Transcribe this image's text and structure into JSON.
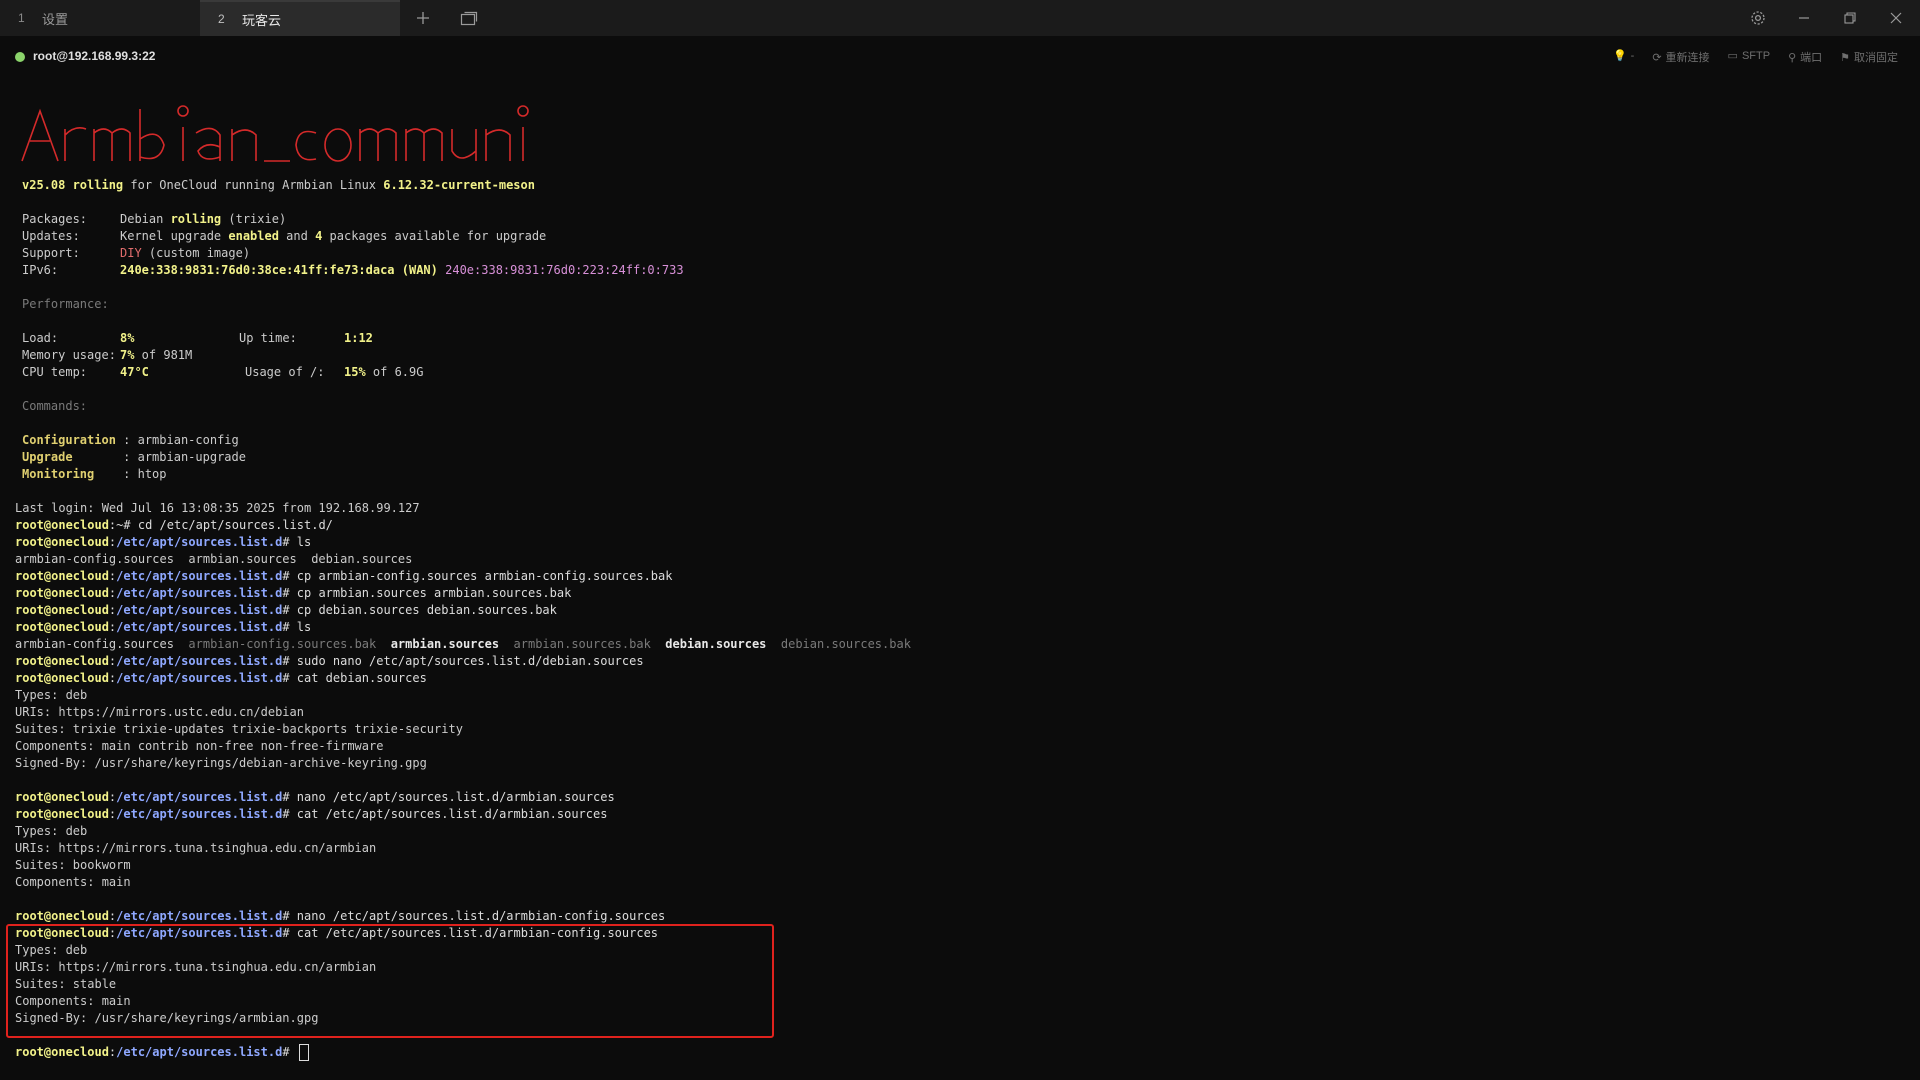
{
  "tabs": [
    {
      "num": "1",
      "label": "设置"
    },
    {
      "num": "2",
      "label": "玩客云"
    }
  ],
  "session": {
    "host": "root@192.168.99.3:22",
    "actions": [
      {
        "icon": "bulb-icon",
        "label": "-"
      },
      {
        "icon": "refresh-icon",
        "label": "重新连接"
      },
      {
        "icon": "folder-icon",
        "label": "SFTP"
      },
      {
        "icon": "plug-icon",
        "label": "端口"
      },
      {
        "icon": "pin-icon",
        "label": "取消固定"
      }
    ]
  },
  "banner_art_text": "Armbian_community",
  "motd": {
    "version": "v25.08 rolling",
    "for_text": " for OneCloud running Armbian Linux ",
    "kernel": "6.12.32-current-meson",
    "packages_label": "Packages:",
    "packages_value_a": "Debian ",
    "packages_value_b": "rolling",
    "packages_value_c": " (trixie)",
    "updates_label": "Updates:",
    "updates_a": "Kernel upgrade ",
    "updates_b": "enabled",
    "updates_c": " and ",
    "updates_d": "4",
    "updates_e": " packages available for upgrade",
    "support_label": "Support:",
    "support_a": "DIY",
    "support_b": " (custom image)",
    "ipv6_label": "IPv6:",
    "ipv6_a": "240e:338:9831:76d0:38ce:41ff:fe73:daca (WAN)",
    "ipv6_b": "240e:338:9831:76d0:223:24ff:0:733",
    "performance_label": "Performance:",
    "load_label": "Load:",
    "load_value": "8%",
    "uptime_label": "Up time:",
    "uptime_value": "1:12",
    "mem_label": "Memory usage:",
    "mem_value": "7%",
    "mem_of": " of 981M",
    "cpu_label": "CPU temp:",
    "cpu_value": "47°C",
    "usage_label": "Usage of /:",
    "usage_value": "15%",
    "usage_of": " of 6.9G",
    "commands_label": "Commands:",
    "cmd1_name": "Configuration",
    "cmd1_value": " : armbian-config",
    "cmd2_name": "Upgrade",
    "cmd2_value": "       : armbian-upgrade",
    "cmd3_name": "Monitoring",
    "cmd3_value": "    : htop"
  },
  "prompt": {
    "user": "root@onecloud",
    "colon": ":",
    "path": "/etc/apt/sources.list.d",
    "home_path": "~",
    "hash": "# "
  },
  "session_log": {
    "last_login": "Last login: Wed Jul 16 13:08:35 2025 from 192.168.99.127",
    "cmd_cd": "cd /etc/apt/sources.list.d/",
    "cmd_ls": "ls",
    "ls1": "armbian-config.sources  armbian.sources  debian.sources",
    "cmd_cp1": "cp armbian-config.sources armbian-config.sources.bak",
    "cmd_cp2": "cp armbian.sources armbian.sources.bak",
    "cmd_cp3": "cp debian.sources debian.sources.bak",
    "ls2": [
      {
        "name": "armbian-config.sources",
        "style": "normal"
      },
      {
        "name": "armbian-config.sources.bak",
        "style": "dim"
      },
      {
        "name": "armbian.sources",
        "style": "bright"
      },
      {
        "name": "armbian.sources.bak",
        "style": "dim"
      },
      {
        "name": "debian.sources",
        "style": "bright"
      },
      {
        "name": "debian.sources.bak",
        "style": "dim"
      }
    ],
    "cmd_nano_debian": "sudo nano /etc/apt/sources.list.d/debian.sources",
    "cmd_cat_debian": "cat debian.sources",
    "debian_out": [
      "Types: deb",
      "URIs: https://mirrors.ustc.edu.cn/debian",
      "Suites: trixie trixie-updates trixie-backports trixie-security",
      "Components: main contrib non-free non-free-firmware",
      "Signed-By: /usr/share/keyrings/debian-archive-keyring.gpg"
    ],
    "cmd_nano_armbian": "nano /etc/apt/sources.list.d/armbian.sources",
    "cmd_cat_armbian": "cat /etc/apt/sources.list.d/armbian.sources",
    "armbian_out": [
      "Types: deb",
      "URIs: https://mirrors.tuna.tsinghua.edu.cn/armbian",
      "Suites: bookworm",
      "Components: main"
    ],
    "cmd_nano_config": "nano /etc/apt/sources.list.d/armbian-config.sources",
    "cmd_cat_config": "cat /etc/apt/sources.list.d/armbian-config.sources",
    "config_out": [
      "Types: deb",
      "URIs: https://mirrors.tuna.tsinghua.edu.cn/armbian",
      "Suites: stable",
      "Components: main",
      "Signed-By: /usr/share/keyrings/armbian.gpg"
    ]
  },
  "colors": {
    "background": "#0c0c0c",
    "prompt_user": "#f2f28a",
    "prompt_path": "#8fa8ff",
    "highlight_box": "#e0221d",
    "banner": "#d42a2a"
  }
}
